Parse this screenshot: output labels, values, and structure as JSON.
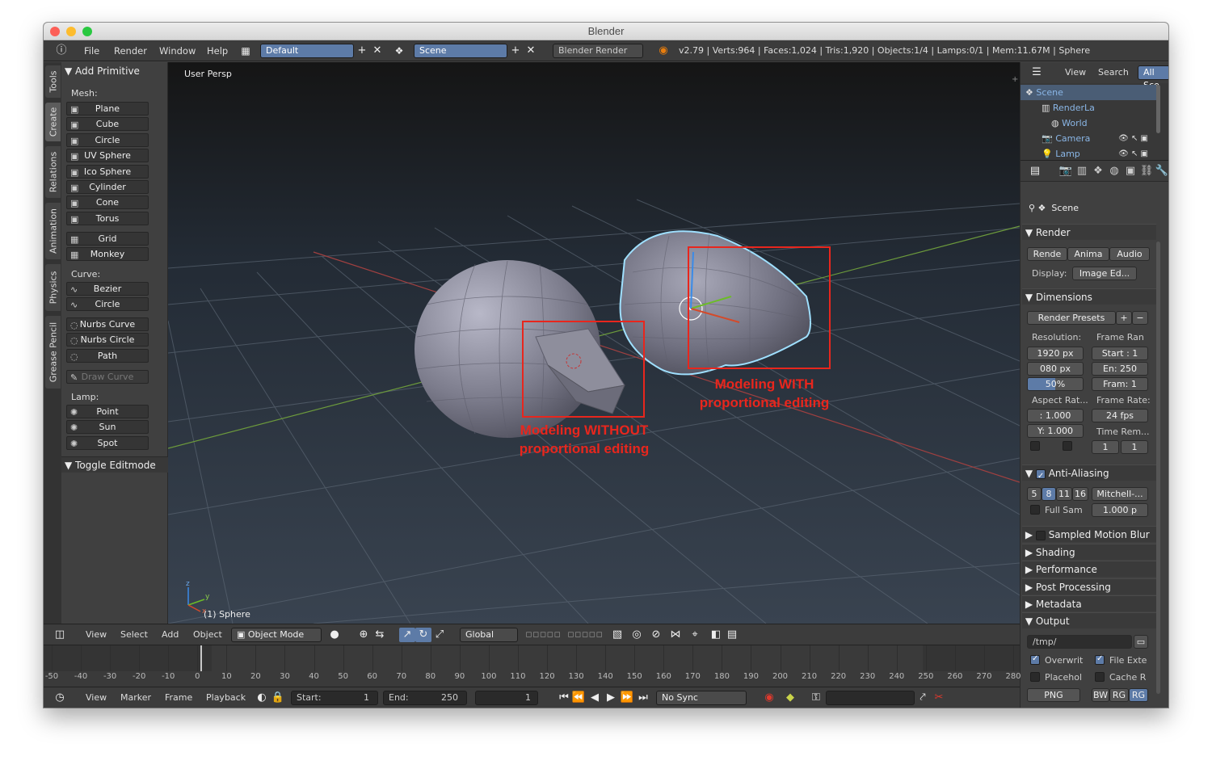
{
  "window": {
    "title": "Blender"
  },
  "menubar": {
    "menus": [
      "File",
      "Render",
      "Window",
      "Help"
    ],
    "layout": "Default",
    "scene": "Scene",
    "engine": "Blender Render",
    "stats": "v2.79 | Verts:964 | Faces:1,024 | Tris:1,920 | Objects:1/4 | Lamps:0/1 | Mem:11.67M | Sphere"
  },
  "left_tabs": [
    "Tools",
    "Create",
    "Relations",
    "Animation",
    "Physics",
    "Grease Pencil"
  ],
  "toolpanel": {
    "header": "Add Primitive",
    "mesh_label": "Mesh:",
    "mesh": [
      "Plane",
      "Cube",
      "Circle",
      "UV Sphere",
      "Ico Sphere",
      "Cylinder",
      "Cone",
      "Torus"
    ],
    "mesh2": [
      "Grid",
      "Monkey"
    ],
    "curve_label": "Curve:",
    "curve": [
      "Bezier",
      "Circle"
    ],
    "curve2": [
      "Nurbs Curve",
      "Nurbs Circle",
      "Path"
    ],
    "draw_curve": "Draw Curve",
    "lamp_label": "Lamp:",
    "lamp": [
      "Point",
      "Sun",
      "Spot"
    ],
    "toggle_editmode": "Toggle Editmode"
  },
  "viewport": {
    "view_label": "User Persp",
    "object_label": "(1) Sphere",
    "annotation_without": [
      "Modeling WITHOUT",
      "proportional editing"
    ],
    "annotation_with": [
      "Modeling WITH",
      "proportional editing"
    ],
    "axis_labels": {
      "z": "z",
      "y": "y",
      "x": "x"
    }
  },
  "outliner": {
    "header": {
      "view": "View",
      "search": "Search",
      "filter": "All Sce"
    },
    "items": [
      "Scene",
      "RenderLa",
      "World",
      "Camera",
      "Lamp"
    ]
  },
  "properties": {
    "context": "Scene",
    "render": {
      "title": "Render",
      "buttons": [
        "Rende",
        "Anima",
        "Audio"
      ],
      "display_label": "Display:",
      "display_value": "Image Ed..."
    },
    "dimensions": {
      "title": "Dimensions",
      "presets": "Render Presets",
      "resolution_label": "Resolution:",
      "res_x": "1920 px",
      "res_y": "080 px",
      "res_pct": "50%",
      "frame_range_label": "Frame Ran",
      "start": "Start : 1",
      "end": "En: 250",
      "frame_step": "Fram: 1",
      "aspect_label": "Aspect Rat...",
      "aspect_x": ": 1.000",
      "aspect_y": "Y: 1.000",
      "frame_rate_label": "Frame Rate:",
      "fps": "24 fps",
      "time_remap_label": "Time Rem...",
      "remap_old": "1",
      "remap_new": "1"
    },
    "anti_aliasing": {
      "title": "Anti-Aliasing",
      "samples": [
        "5",
        "8",
        "11",
        "16"
      ],
      "filter": "Mitchell-...",
      "full_sample": "Full Sam",
      "size": "1.000 p"
    },
    "sampled_motion_blur": "Sampled Motion Blur",
    "collapsed": [
      "Shading",
      "Performance",
      "Post Processing",
      "Metadata"
    ],
    "output": {
      "title": "Output",
      "path": "/tmp/",
      "overwrite": "Overwrit",
      "file_ext": "File Exte",
      "placeholders": "Placehol",
      "cache": "Cache R",
      "format": "PNG",
      "color_modes": [
        "BW",
        "RG",
        "RG"
      ]
    }
  },
  "vp_header": {
    "menus": [
      "View",
      "Select",
      "Add",
      "Object"
    ],
    "mode": "Object Mode",
    "orientation": "Global"
  },
  "timeline": {
    "ticks": [
      "-50",
      "-40",
      "-30",
      "-20",
      "-10",
      "0",
      "10",
      "20",
      "30",
      "40",
      "50",
      "60",
      "70",
      "80",
      "90",
      "100",
      "110",
      "120",
      "130",
      "140",
      "150",
      "160",
      "170",
      "180",
      "190",
      "200",
      "210",
      "220",
      "230",
      "240",
      "250",
      "260",
      "270",
      "280"
    ],
    "current_frame": 1
  },
  "tl_header": {
    "menus": [
      "View",
      "Marker",
      "Frame",
      "Playback"
    ],
    "start_label": "Start:",
    "start": "1",
    "end_label": "End:",
    "end": "250",
    "current": "1",
    "sync": "No Sync"
  }
}
